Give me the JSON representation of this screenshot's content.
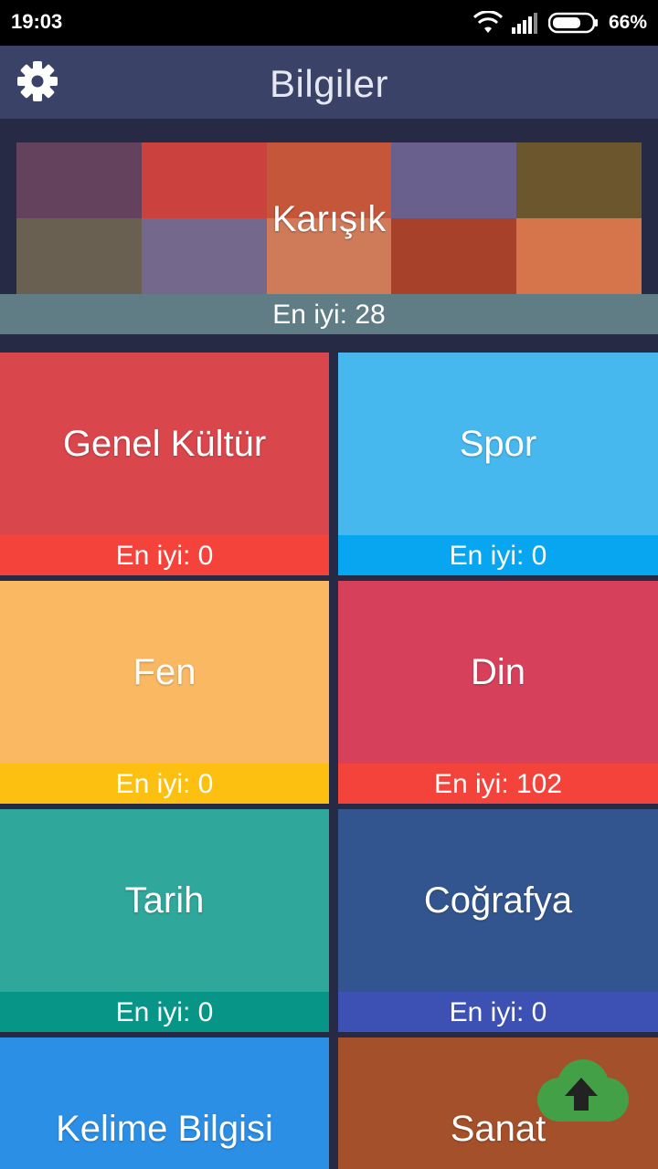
{
  "status_bar": {
    "time": "19:03",
    "battery": "66%",
    "icons": [
      "wifi-icon",
      "signal-icon",
      "battery-icon"
    ]
  },
  "app_bar": {
    "title": "Bilgiler",
    "settings_icon": "gear-icon"
  },
  "featured": {
    "title": "Karışık",
    "score": "En iyi: 28"
  },
  "categories": [
    {
      "title": "Genel Kültür",
      "score": "En iyi: 0",
      "art_color": "#d9474d",
      "bar_color": "#f4433a"
    },
    {
      "title": "Spor",
      "score": "En iyi: 0",
      "art_color": "#47b8ee",
      "bar_color": "#08a6f0"
    },
    {
      "title": "Fen",
      "score": "En iyi: 0",
      "art_color": "#fbb862",
      "bar_color": "#fdc011"
    },
    {
      "title": "Din",
      "score": "En iyi: 102",
      "art_color": "#d7405a",
      "bar_color": "#f4433a"
    },
    {
      "title": "Tarih",
      "score": "En iyi: 0",
      "art_color": "#2fa79b",
      "bar_color": "#079588"
    },
    {
      "title": "Coğrafya",
      "score": "En iyi: 0",
      "art_color": "#33558f",
      "bar_color": "#3d50b3"
    },
    {
      "title": "Kelime Bilgisi",
      "score": "",
      "art_color": "#2b8fe6",
      "bar_color": "#2196f3"
    },
    {
      "title": "Sanat",
      "score": "",
      "art_color": "#a4502a",
      "bar_color": "#a4502a"
    }
  ],
  "fab": {
    "icon": "cloud-upload-icon",
    "color": "#43a047"
  }
}
